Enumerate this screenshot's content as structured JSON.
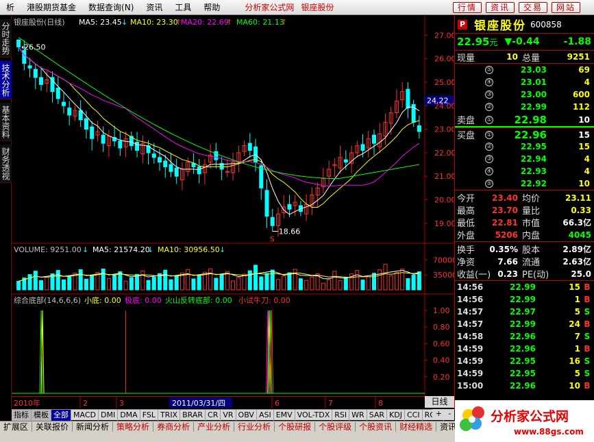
{
  "menu": {
    "items": [
      "析",
      "港股期货基金",
      "数据查询(N)",
      "资讯",
      "工具",
      "帮助"
    ],
    "links": [
      "分析家公式网",
      "银座股份"
    ],
    "buttons": [
      "行情",
      "资讯",
      "交易",
      "网站"
    ]
  },
  "left_tabs": [
    "分时走势",
    "技术分析",
    "基本资料",
    "财务透视"
  ],
  "main_chart": {
    "header": {
      "name": "银座股份(日线)",
      "ma5_label": "MA5: 23.45",
      "ma10_label": "MA10: 23.30",
      "ma20_label": "MA20: 22.69",
      "ma60_label": "MA60: 21.13"
    },
    "price_ticks": [
      "27.00",
      "26.00",
      "25.00",
      "24.00",
      "23.00",
      "22.00",
      "21.00",
      "20.00",
      "19.00"
    ],
    "high_marker": "26.50",
    "low_marker": "18.66",
    "current_price_tag": "24.22",
    "low_marker_symbol": "S"
  },
  "volume_chart": {
    "header": {
      "vol": "VOLUME: 9251.00",
      "ma5": "MA5: 21574.20",
      "ma10": "MA10: 30956.50"
    },
    "ticks": [
      "70000",
      "35000"
    ]
  },
  "indicator_chart": {
    "header": {
      "name": "综合底部(14,6,6,6)",
      "xiaodi": "小底: 0.00",
      "jidi": "极底: 0.00",
      "huoshan": "火山反转底部: 0.00",
      "xiaoshi": "小试牛刀: 0.00"
    },
    "ticks": [
      "1.00",
      "0.80",
      "0.60",
      "0.40",
      "0.20"
    ]
  },
  "date_axis": {
    "year": "2010年",
    "months": [
      "2",
      "3",
      "6",
      "7",
      "8"
    ],
    "cursor_date": "2011/03/31/四",
    "period": "日线"
  },
  "indicator_tabs": [
    "指标",
    "模板",
    "全部",
    "MACD",
    "DMI",
    "DMA",
    "FSL",
    "TRIX",
    "BRAR",
    "CR",
    "VR",
    "OBV",
    "ASI",
    "EMV",
    "VOL-TDX",
    "RSI",
    "WR",
    "SAR",
    "KDJ",
    "CCI",
    "ROC"
  ],
  "nav_buttons": [
    "+",
    "-"
  ],
  "stock": {
    "name": "银座股份",
    "code": "600858",
    "price": "22.95",
    "unit": "元",
    "change": "▼-0.44",
    "pct": "-1.88",
    "vol_now_label": "现量",
    "vol_now": "10",
    "vol_total_label": "总量",
    "vol_total": "9251"
  },
  "asks": [
    {
      "no": "⑤",
      "price": "23.03",
      "vol": "69"
    },
    {
      "no": "④",
      "price": "23.01",
      "vol": "4"
    },
    {
      "no": "③",
      "price": "23.00",
      "vol": "600"
    },
    {
      "no": "②",
      "price": "22.99",
      "vol": "112"
    },
    {
      "label": "卖盘",
      "no": "①",
      "price": "22.98",
      "vol": "10"
    }
  ],
  "bids": [
    {
      "label": "买盘",
      "no": "①",
      "price": "22.96",
      "vol": "15"
    },
    {
      "no": "②",
      "price": "22.95",
      "vol": "15"
    },
    {
      "no": "③",
      "price": "22.94",
      "vol": "4"
    },
    {
      "no": "④",
      "price": "22.93",
      "vol": "4"
    },
    {
      "no": "⑤",
      "price": "22.92",
      "vol": "10"
    }
  ],
  "stats1": [
    [
      "今开",
      "23.40",
      "red",
      "均价",
      "23.11",
      "yellow"
    ],
    [
      "最高",
      "23.70",
      "red",
      "量比",
      "0.33",
      "yellow"
    ],
    [
      "最低",
      "22.81",
      "red",
      "市值",
      "66.3亿",
      "white"
    ],
    [
      "外盘",
      "5206",
      "red",
      "内盘",
      "4045",
      "green"
    ]
  ],
  "stats2": [
    [
      "换手",
      "0.35%",
      "white",
      "股本",
      "2.89亿",
      "white"
    ],
    [
      "净资",
      "7.66",
      "white",
      "流通",
      "2.63亿",
      "white"
    ],
    [
      "收益(一)",
      "0.23",
      "white",
      "PE(动)",
      "25.0",
      "white"
    ]
  ],
  "ticks": [
    [
      "14:56",
      "22.99",
      "15",
      "B"
    ],
    [
      "14:56",
      "22.99",
      "1",
      "B"
    ],
    [
      "14:57",
      "22.97",
      "5",
      "S"
    ],
    [
      "14:57",
      "22.99",
      "24",
      "B"
    ],
    [
      "14:58",
      "22.96",
      "7",
      "S"
    ],
    [
      "14:59",
      "22.96",
      "1",
      "B"
    ],
    [
      "14:59",
      "22.95",
      "16",
      "S"
    ],
    [
      "14:59",
      "22.95",
      "5",
      "S"
    ],
    [
      "15:00",
      "22.96",
      "10",
      "B"
    ]
  ],
  "bottom_bar": {
    "row1": [
      "扩展区",
      "关联报价",
      "新闻分析",
      "策略分析",
      "券商分析",
      "产业分析",
      "行业分析",
      "个股研报",
      "个股评级",
      "个股资讯",
      "财经精选",
      "资讯工场"
    ],
    "row2": []
  },
  "logo": {
    "title": "分析家公式网",
    "url": "www.88gs.com"
  },
  "colors": {
    "ma5": "#ffffff",
    "ma10": "#ffff00",
    "ma20": "#ff00ff",
    "ma60": "#00ff00",
    "up": "#ff3030",
    "down": "#00ffff"
  },
  "chart_data": [
    {
      "type": "candlestick",
      "title": "银座股份(日线)",
      "ylim": [
        18.5,
        27.3
      ],
      "close_approx": [
        26.5,
        25.8,
        25.6,
        25.2,
        24.9,
        25.1,
        24.6,
        24.3,
        24.0,
        23.6,
        23.8,
        23.4,
        23.0,
        22.6,
        22.9,
        22.4,
        22.7,
        22.5,
        22.2,
        22.6,
        22.3,
        22.1,
        22.4,
        22.0,
        21.8,
        21.6,
        21.4,
        21.2,
        21.0,
        21.3,
        21.6,
        21.4,
        21.1,
        21.5,
        21.9,
        21.7,
        21.3,
        21.2,
        21.6,
        22.0,
        22.3,
        22.1,
        21.6,
        20.5,
        19.3,
        18.9,
        19.4,
        19.7,
        19.6,
        19.9,
        19.5,
        19.8,
        20.2,
        20.5,
        20.9,
        21.3,
        21.5,
        21.8,
        21.6,
        22.0,
        22.3,
        22.1,
        22.6,
        22.4,
        22.8,
        23.3,
        23.7,
        24.2,
        24.6,
        23.9,
        23.3,
        22.9
      ],
      "ma_values_last": {
        "MA5": 23.45,
        "MA10": 23.3,
        "MA20": 22.69,
        "MA60": 21.13
      }
    },
    {
      "type": "bar",
      "title": "VOLUME",
      "ylim": [
        0,
        80000
      ],
      "last": 9251.0,
      "ma5": 21574.2,
      "ma10": 30956.5
    },
    {
      "type": "bar",
      "title": "综合底部(14,6,6,6)",
      "ylim": [
        0,
        1
      ],
      "signals": [
        {
          "series": "小底",
          "index": 4,
          "value": 1
        },
        {
          "series": "极底",
          "index": 19,
          "value": 1
        },
        {
          "series": "火山反转底部",
          "index": 47,
          "value": 1
        },
        {
          "series": "小试牛刀",
          "index": 48,
          "value": 1
        }
      ]
    }
  ]
}
